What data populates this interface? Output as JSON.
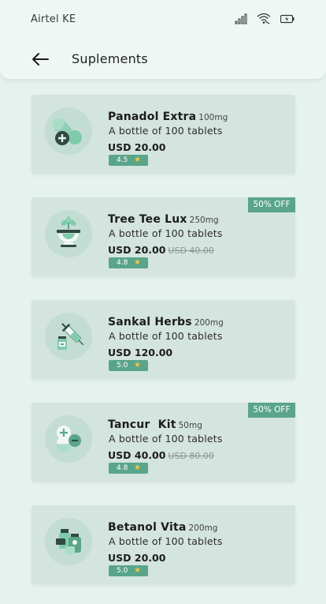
{
  "status_bar": {
    "carrier": "Airtel KE"
  },
  "header": {
    "title": "Suplements"
  },
  "products": [
    {
      "name": "Panadol Extra",
      "dose": "100mg",
      "description": "A bottle of 100 tablets",
      "price": "USD 20.00",
      "old_price": "",
      "rating": "4.5",
      "discount": "",
      "icon": "capsules-icon"
    },
    {
      "name": "Tree Tee Lux",
      "dose": "250mg",
      "description": "A bottle of 100 tablets",
      "price": "USD 20.00",
      "old_price": "USD 40.00",
      "rating": "4.8",
      "discount": "50% OFF",
      "icon": "mortar-herb-icon"
    },
    {
      "name": "Sankal Herbs",
      "dose": "200mg",
      "description": "A bottle of 100 tablets",
      "price": "USD 120.00",
      "old_price": "",
      "rating": "5.0",
      "discount": "",
      "icon": "syringe-vial-icon"
    },
    {
      "name": "Tancur  Kit",
      "dose": "50mg",
      "description": "A bottle of 100 tablets",
      "price": "USD 40.00",
      "old_price": "USD 80.00",
      "rating": "4.8",
      "discount": "50% OFF",
      "icon": "plus-minus-pills-icon"
    },
    {
      "name": "Betanol Vita",
      "dose": "200mg",
      "description": "A bottle of 100 tablets",
      "price": "USD 20.00",
      "old_price": "",
      "rating": "5.0",
      "discount": "",
      "icon": "pill-bottles-icon"
    }
  ],
  "colors": {
    "background": "#e6f2ee",
    "card": "#d4e4de",
    "accent": "#5aa58a",
    "star": "#f4c542"
  }
}
